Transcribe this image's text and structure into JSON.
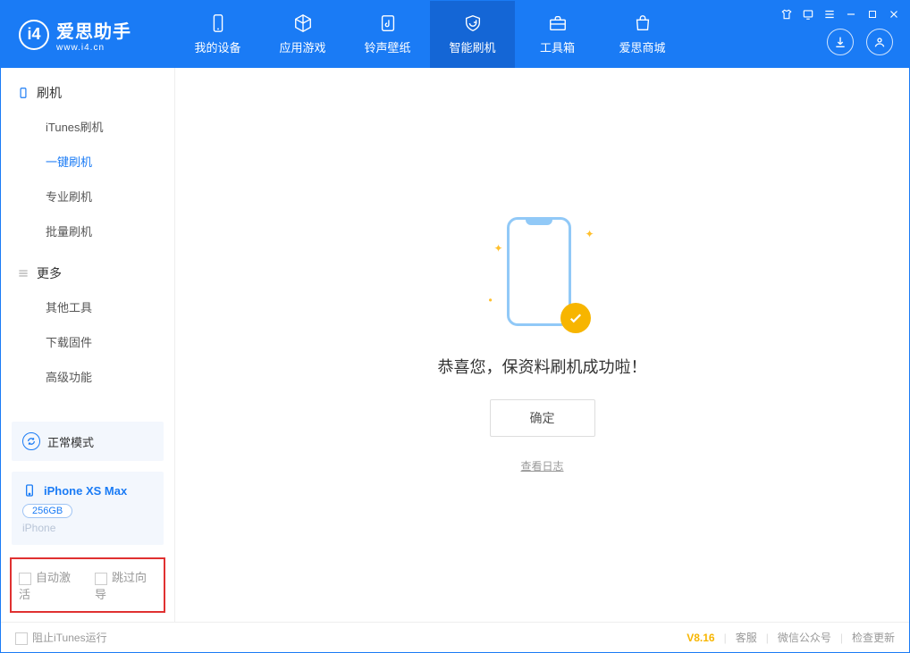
{
  "app": {
    "name": "爱思助手",
    "site": "www.i4.cn"
  },
  "nav": {
    "items": [
      {
        "label": "我的设备"
      },
      {
        "label": "应用游戏"
      },
      {
        "label": "铃声壁纸"
      },
      {
        "label": "智能刷机"
      },
      {
        "label": "工具箱"
      },
      {
        "label": "爱思商城"
      }
    ],
    "active_index": 3
  },
  "sidebar": {
    "group1": {
      "title": "刷机",
      "items": [
        "iTunes刷机",
        "一键刷机",
        "专业刷机",
        "批量刷机"
      ],
      "active_index": 1
    },
    "group2": {
      "title": "更多",
      "items": [
        "其他工具",
        "下载固件",
        "高级功能"
      ]
    }
  },
  "mode_card": {
    "label": "正常模式"
  },
  "device": {
    "name": "iPhone XS Max",
    "capacity": "256GB",
    "type": "iPhone"
  },
  "options": {
    "auto_activate": "自动激活",
    "skip_guide": "跳过向导"
  },
  "main": {
    "success": "恭喜您，保资料刷机成功啦！",
    "ok": "确定",
    "view_log": "查看日志"
  },
  "footer": {
    "block_itunes": "阻止iTunes运行",
    "version": "V8.16",
    "service": "客服",
    "wechat": "微信公众号",
    "check_update": "检查更新"
  }
}
